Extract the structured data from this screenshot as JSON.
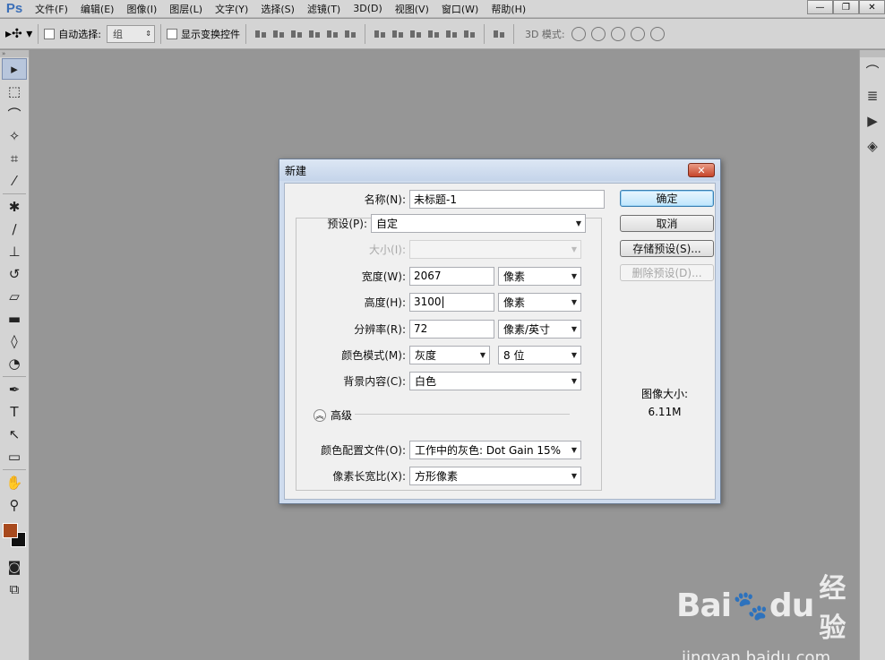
{
  "app": {
    "logo": "Ps",
    "menu": [
      "文件(F)",
      "编辑(E)",
      "图像(I)",
      "图层(L)",
      "文字(Y)",
      "选择(S)",
      "滤镜(T)",
      "3D(D)",
      "视图(V)",
      "窗口(W)",
      "帮助(H)"
    ],
    "window_controls": [
      "—",
      "❐",
      "✕"
    ]
  },
  "options_bar": {
    "auto_select_label": "自动选择:",
    "auto_select_value": "组",
    "show_transform_label": "显示变换控件",
    "mode_3d_label": "3D 模式:"
  },
  "dialog": {
    "title": "新建",
    "close_label": "✕",
    "name_label": "名称(N):",
    "name_value": "未标题-1",
    "preset_label": "预设(P):",
    "preset_value": "自定",
    "size_label": "大小(I):",
    "size_value": "",
    "width_label": "宽度(W):",
    "width_value": "2067",
    "width_unit": "像素",
    "height_label": "高度(H):",
    "height_value": "3100",
    "height_unit": "像素",
    "resolution_label": "分辨率(R):",
    "resolution_value": "72",
    "resolution_unit": "像素/英寸",
    "color_mode_label": "颜色模式(M):",
    "color_mode_value": "灰度",
    "bit_depth_value": "8 位",
    "background_label": "背景内容(C):",
    "background_value": "白色",
    "advanced_label": "高级",
    "color_profile_label": "颜色配置文件(O):",
    "color_profile_value": "工作中的灰色: Dot Gain 15%",
    "pixel_aspect_label": "像素长宽比(X):",
    "pixel_aspect_value": "方形像素",
    "ok_label": "确定",
    "cancel_label": "取消",
    "save_preset_label": "存储预设(S)...",
    "delete_preset_label": "删除预设(D)...",
    "image_size_label": "图像大小:",
    "image_size_value": "6.11M"
  },
  "watermark": {
    "brand": "Bai",
    "brand_suffix": "du",
    "brand_cn": "经验",
    "url": "jingyan.baidu.com"
  },
  "colors": {
    "foreground": "#a84a1e",
    "background": "#111111",
    "canvas": "#969696"
  }
}
